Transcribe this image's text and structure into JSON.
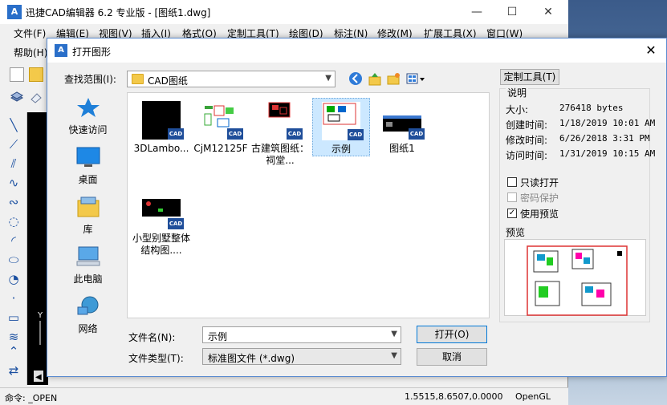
{
  "app": {
    "title": "迅捷CAD编辑器 6.2 专业版 - [图纸1.dwg]",
    "logo_text": "A",
    "menus": [
      "文件(F)",
      "编辑(E)",
      "视图(V)",
      "插入(I)",
      "格式(O)",
      "定制工具(T)",
      "绘图(D)",
      "标注(N)",
      "修改(M)",
      "扩展工具(X)",
      "窗口(W)"
    ],
    "menu_row2": [
      "帮助(H)"
    ],
    "window_controls": {
      "minimize": "—",
      "maximize": "☐",
      "close": "✕"
    }
  },
  "status": {
    "command": "命令:  _OPEN",
    "coords": "1.5515,8.6507,0.0000",
    "renderer": "OpenGL"
  },
  "dialog": {
    "title": "打开图形",
    "logo_text": "A",
    "close": "✕",
    "lookin_label": "查找范围(I):",
    "lookin_value": "CAD图纸",
    "places": [
      {
        "label": "快速访问",
        "icon": "star-icon"
      },
      {
        "label": "桌面",
        "icon": "desktop-icon"
      },
      {
        "label": "库",
        "icon": "library-icon"
      },
      {
        "label": "此电脑",
        "icon": "computer-icon"
      },
      {
        "label": "网络",
        "icon": "network-icon"
      }
    ],
    "files": [
      {
        "name": "3DLambo...",
        "badge": "CAD"
      },
      {
        "name": "CjM12125F",
        "badge": "CAD"
      },
      {
        "name": "古建筑图纸：祠堂...",
        "badge": "CAD"
      },
      {
        "name": "示例",
        "badge": "CAD"
      },
      {
        "name": "图纸1",
        "badge": "CAD"
      },
      {
        "name": "小型别墅整体结构图....",
        "badge": "CAD"
      }
    ],
    "filename_label": "文件名(N):",
    "filename_value": "示例",
    "filetype_label": "文件类型(T):",
    "filetype_value": "标准图文件 (*.dwg)",
    "open_button": "打开(O)",
    "cancel_button": "取消",
    "custom_tools_button": "定制工具(T)",
    "info_title": "说明",
    "info": [
      {
        "key": "大小:",
        "value": "276418 bytes"
      },
      {
        "key": "创建时间:",
        "value": "1/18/2019 10:01 AM"
      },
      {
        "key": "修改时间:",
        "value": "6/26/2018 3:31 PM"
      },
      {
        "key": "访问时间:",
        "value": "1/31/2019 10:15 AM"
      }
    ],
    "readonly_label": "只读打开",
    "readonly_checked": false,
    "password_label": "密码保护",
    "password_checked": false,
    "preview_checkbox_label": "使用预览",
    "preview_checked": true,
    "preview_title": "预览"
  }
}
